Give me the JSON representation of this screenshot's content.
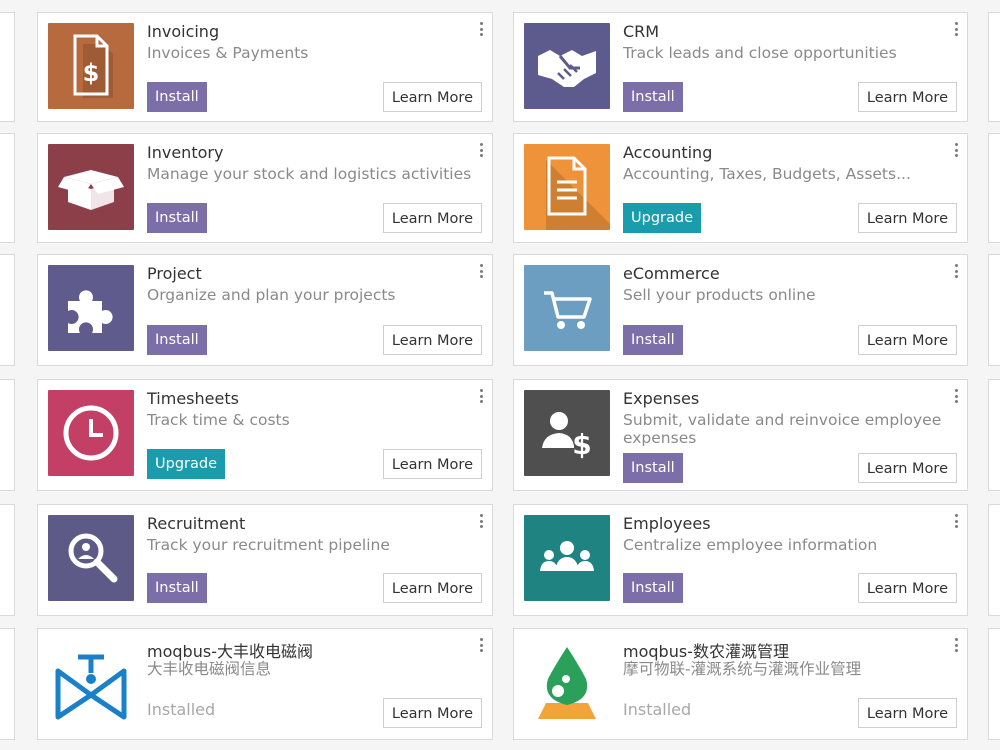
{
  "apps": [
    {
      "id": "invoicing",
      "name": "Invoicing",
      "summary": "Invoices & Payments",
      "action": "Install",
      "icon": "invoice-dollar-icon",
      "color": "#b86a3f"
    },
    {
      "id": "crm",
      "name": "CRM",
      "summary": "Track leads and close opportunities",
      "action": "Install",
      "icon": "handshake-icon",
      "color": "#5d5a8e"
    },
    {
      "id": "inventory",
      "name": "Inventory",
      "summary": "Manage your stock and logistics activities",
      "action": "Install",
      "icon": "open-box-icon",
      "color": "#8c3f48"
    },
    {
      "id": "accounting",
      "name": "Accounting",
      "summary": "Accounting, Taxes, Budgets, Assets...",
      "action": "Upgrade",
      "icon": "document-icon",
      "color": "#ee9339"
    },
    {
      "id": "project",
      "name": "Project",
      "summary": "Organize and plan your projects",
      "action": "Install",
      "icon": "puzzle-piece-icon",
      "color": "#5f5b8c"
    },
    {
      "id": "ecommerce",
      "name": "eCommerce",
      "summary": "Sell your products online",
      "action": "Install",
      "icon": "shopping-cart-icon",
      "color": "#6b9ec1"
    },
    {
      "id": "timesheets",
      "name": "Timesheets",
      "summary": "Track time & costs",
      "action": "Upgrade",
      "icon": "clock-icon",
      "color": "#c43f66"
    },
    {
      "id": "expenses",
      "name": "Expenses",
      "summary": "Submit, validate and reinvoice employee expenses",
      "action": "Install",
      "icon": "user-dollar-icon",
      "color": "#4f4f4f"
    },
    {
      "id": "recruitment",
      "name": "Recruitment",
      "summary": "Track your recruitment pipeline",
      "action": "Install",
      "icon": "magnifier-icon",
      "color": "#5e5a87"
    },
    {
      "id": "employees",
      "name": "Employees",
      "summary": "Centralize employee information",
      "action": "Install",
      "icon": "people-group-icon",
      "color": "#1f8481"
    },
    {
      "id": "moqbus-valve",
      "name": "moqbus-大丰收电磁阀",
      "summary": "大丰收电磁阀信息",
      "action": "Installed",
      "icon": "valve-logo-icon",
      "color": "#1a80c8"
    },
    {
      "id": "moqbus-irrigation",
      "name": "moqbus-数农灌溉管理",
      "summary": "摩可物联-灌溉系统与灌溉作业管理",
      "action": "Installed",
      "icon": "water-drop-logo-icon",
      "color": "#2aa05a"
    }
  ],
  "labels": {
    "learn_more": "Learn More",
    "install": "Install",
    "upgrade": "Upgrade",
    "installed": "Installed"
  },
  "colors": {
    "install_button": "#7c6ea8",
    "upgrade_button": "#1a9cad",
    "card_border": "#d9d9d9",
    "background": "#f5f5f5"
  }
}
